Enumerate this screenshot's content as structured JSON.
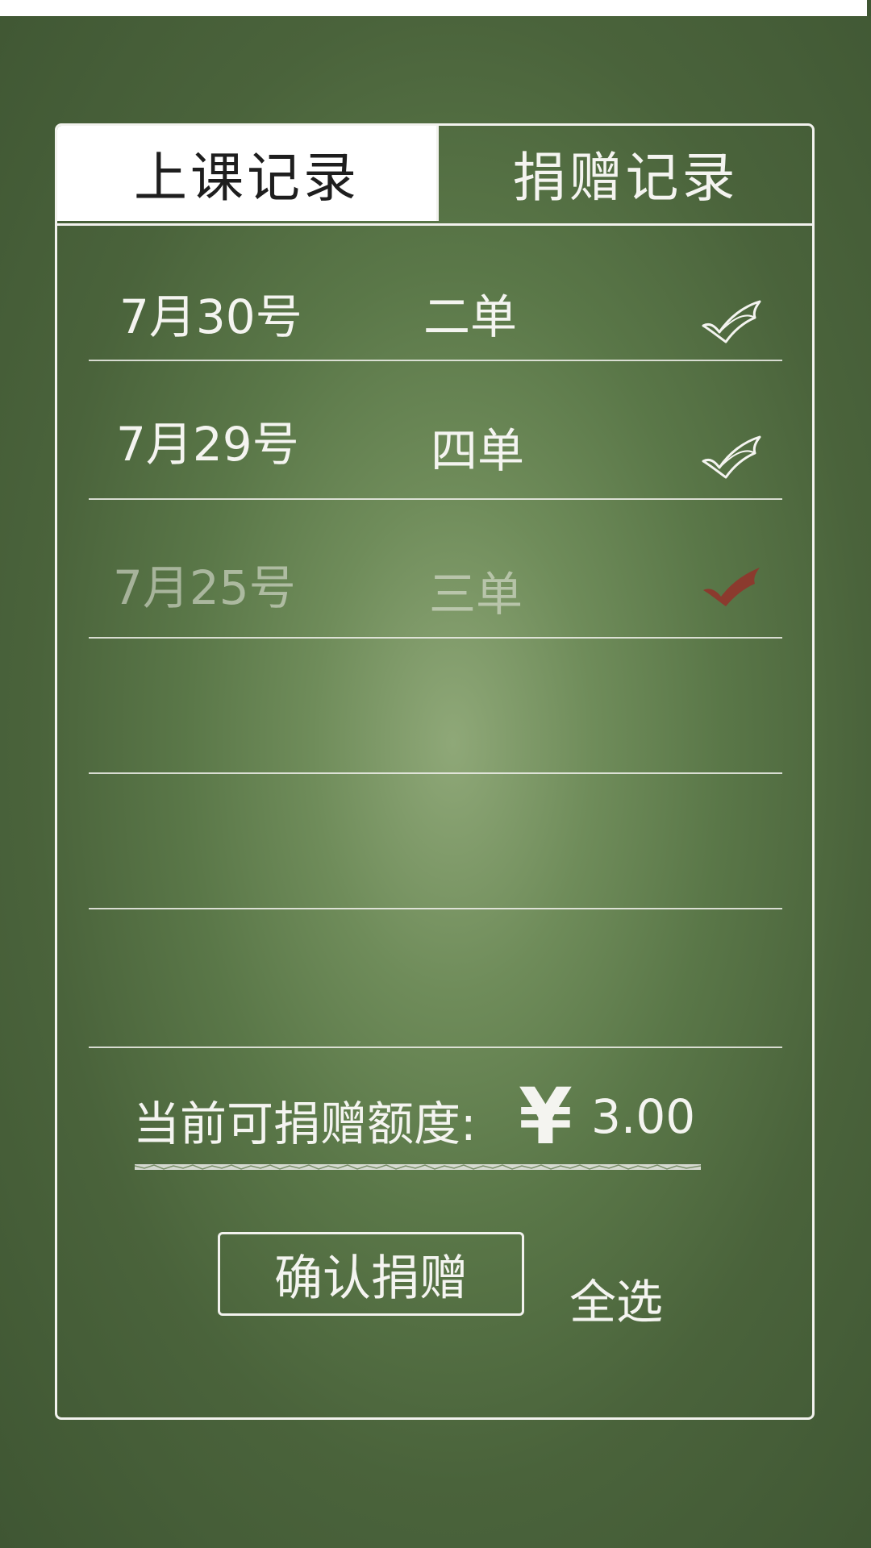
{
  "tabs": [
    {
      "label": "上课记录",
      "active": true
    },
    {
      "label": "捐赠记录",
      "active": false
    }
  ],
  "records": [
    {
      "date": "7月30号",
      "amount": "二单",
      "checked": true,
      "check_icon": "check-outline-icon",
      "dimmed": false
    },
    {
      "date": "7月29号",
      "amount": "四单",
      "checked": true,
      "check_icon": "check-outline-icon",
      "dimmed": false
    },
    {
      "date": "7月25号",
      "amount": "三单",
      "checked": true,
      "check_icon": "check-filled-icon",
      "dimmed": true
    },
    {
      "date": "",
      "amount": "",
      "checked": false,
      "dimmed": false
    },
    {
      "date": "",
      "amount": "",
      "checked": false,
      "dimmed": false
    },
    {
      "date": "",
      "amount": "",
      "checked": false,
      "dimmed": false
    }
  ],
  "quota": {
    "label": "当前可捐赠额度:",
    "currency": "¥",
    "value": "3.00"
  },
  "actions": {
    "confirm_label": "确认捐赠",
    "select_all_label": "全选"
  },
  "colors": {
    "chalkboard": "#5a7748",
    "chalk_white": "#f4f4f0",
    "check_red": "#8b3a2e"
  }
}
